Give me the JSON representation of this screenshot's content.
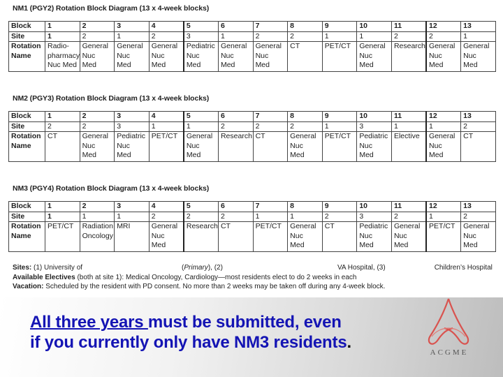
{
  "tables": [
    {
      "title": "NM1 (PGY2) Rotation Block Diagram (13 x 4-week blocks)",
      "row_labels": {
        "block": "Block",
        "site": "Site",
        "rotation": [
          "Rotation",
          "Name"
        ]
      },
      "blocks": [
        "1",
        "2",
        "3",
        "4",
        "5",
        "6",
        "7",
        "8",
        "9",
        "10",
        "11",
        "12",
        "13"
      ],
      "sites": [
        "1",
        "2",
        "1",
        "2",
        "3",
        "1",
        "2",
        "2",
        "1",
        "1",
        "2",
        "2",
        "1"
      ],
      "rotations": [
        [
          "Radio-",
          "pharmacy/",
          "Nuc Med"
        ],
        [
          "General",
          "Nuc",
          "Med"
        ],
        [
          "General",
          "Nuc",
          "Med"
        ],
        [
          "General",
          "Nuc",
          "Med"
        ],
        [
          "Pediatric",
          "Nuc",
          "Med"
        ],
        [
          "General",
          "Nuc",
          "Med"
        ],
        [
          "General",
          "Nuc",
          "Med"
        ],
        [
          "CT"
        ],
        [
          "PET/CT"
        ],
        [
          "General",
          "Nuc",
          "Med"
        ],
        [
          "Research"
        ],
        [
          "General",
          "Nuc",
          "Med"
        ],
        [
          "General",
          "Nuc",
          "Med"
        ]
      ]
    },
    {
      "title": "NM2 (PGY3) Rotation Block Diagram (13 x 4-week blocks)",
      "row_labels": {
        "block": "Block",
        "site": "Site",
        "rotation": [
          "Rotation",
          "Name"
        ]
      },
      "blocks": [
        "1",
        "2",
        "3",
        "4",
        "5",
        "6",
        "7",
        "8",
        "9",
        "10",
        "11",
        "12",
        "13"
      ],
      "sites": [
        "2",
        "2",
        "3",
        "1",
        "1",
        "2",
        "2",
        "2",
        "1",
        "3",
        "1",
        "1",
        "2"
      ],
      "rotations": [
        [
          "CT"
        ],
        [
          "General",
          "Nuc",
          "Med"
        ],
        [
          "Pediatric",
          "Nuc",
          "Med"
        ],
        [
          "PET/CT"
        ],
        [
          "General",
          "Nuc",
          "Med"
        ],
        [
          "Research"
        ],
        [
          "CT"
        ],
        [
          "General",
          "Nuc",
          "Med"
        ],
        [
          "PET/CT"
        ],
        [
          "Pediatric",
          "Nuc",
          "Med"
        ],
        [
          "Elective"
        ],
        [
          "General",
          "Nuc",
          "Med"
        ],
        [
          "CT"
        ]
      ]
    },
    {
      "title": "NM3 (PGY4) Rotation Block Diagram (13 x 4-week blocks)",
      "row_labels": {
        "block": "Block",
        "site": "Site",
        "rotation": [
          "Rotation",
          "Name"
        ]
      },
      "blocks": [
        "1",
        "2",
        "3",
        "4",
        "5",
        "6",
        "7",
        "8",
        "9",
        "10",
        "11",
        "12",
        "13"
      ],
      "sites": [
        "1",
        "1",
        "1",
        "2",
        "2",
        "2",
        "1",
        "1",
        "2",
        "3",
        "2",
        "1",
        "2"
      ],
      "rotations": [
        [
          "PET/CT"
        ],
        [
          "Radiation",
          "Oncology"
        ],
        [
          "MRI"
        ],
        [
          "General",
          "Nuc",
          "Med"
        ],
        [
          "Research"
        ],
        [
          "CT"
        ],
        [
          "PET/CT"
        ],
        [
          "General",
          "Nuc",
          "Med"
        ],
        [
          "CT"
        ],
        [
          "Pediatric",
          "Nuc",
          "Med"
        ],
        [
          "General",
          "Nuc",
          "Med"
        ],
        [
          "PET/CT"
        ],
        [
          "General",
          "Nuc",
          "Med"
        ]
      ]
    }
  ],
  "notes": {
    "sites_label": "Sites:",
    "sites_1": "(1) University of",
    "sites_primary": "Primary",
    "sites_2": "(2)",
    "sites_va": "VA Hospital, (3)",
    "sites_children": "Children’s Hospital",
    "electives_label": "Available Electives",
    "electives_text": " (both at site 1): Medical Oncology, Cardiology—most residents elect to do 2 weeks in each",
    "vacation_label": "Vacation:",
    "vacation_text": "  Scheduled by the resident with PD consent.  No more than 2 weeks may be taken off during any 4-week block."
  },
  "banner": {
    "underlined": "All three years ",
    "line1_rest": "must be submitted, even",
    "line2": "if you currently only have NM3 residents",
    "period": ".",
    "text_color": "#1414b4"
  },
  "logo": {
    "icon": "acgme-logo-icon",
    "text": "ACGME",
    "color": "#d9534f"
  }
}
